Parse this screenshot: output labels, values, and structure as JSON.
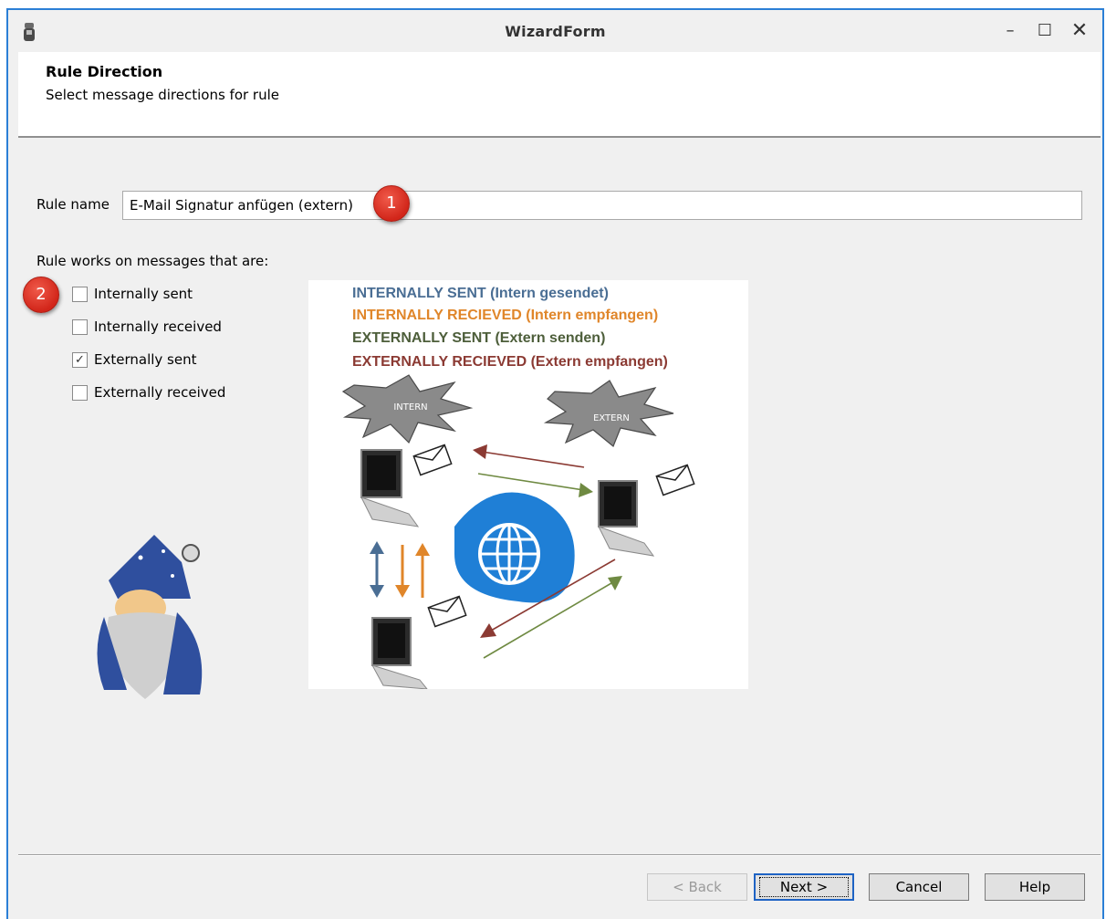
{
  "window": {
    "title": "WizardForm",
    "controls": {
      "minimize": "–",
      "maximize": "☐",
      "close": "✕"
    }
  },
  "header": {
    "title": "Rule Direction",
    "subtitle": "Select message directions for rule"
  },
  "rule_name": {
    "label": "Rule name",
    "value": "E-Mail Signatur anfügen (extern)"
  },
  "badges": [
    "1",
    "2"
  ],
  "directions": {
    "label": "Rule works on messages that are:",
    "options": [
      {
        "label": "Internally sent",
        "checked": false
      },
      {
        "label": "Internally received",
        "checked": false
      },
      {
        "label": "Externally sent",
        "checked": true
      },
      {
        "label": "Externally received",
        "checked": false
      }
    ]
  },
  "diagram": {
    "legend": [
      {
        "text": "INTERNALLY SENT (Intern gesendet)",
        "color": "#4a6e94"
      },
      {
        "text": "INTERNALLY RECIEVED (Intern empfangen)",
        "color": "#e0862a"
      },
      {
        "text": "EXTERNALLY SENT (Extern senden)",
        "color": "#4d5e3a"
      },
      {
        "text": "EXTERNALLY RECIEVED (Extern empfangen)",
        "color": "#8b3a33"
      }
    ],
    "intern_label": "INTERN",
    "extern_label": "EXTERN"
  },
  "buttons": {
    "back": "< Back",
    "next": "Next >",
    "cancel": "Cancel",
    "help": "Help"
  },
  "colors": {
    "accent": "#2b7fd6",
    "badge": "#d2261a",
    "globe": "#1f7fd6"
  }
}
